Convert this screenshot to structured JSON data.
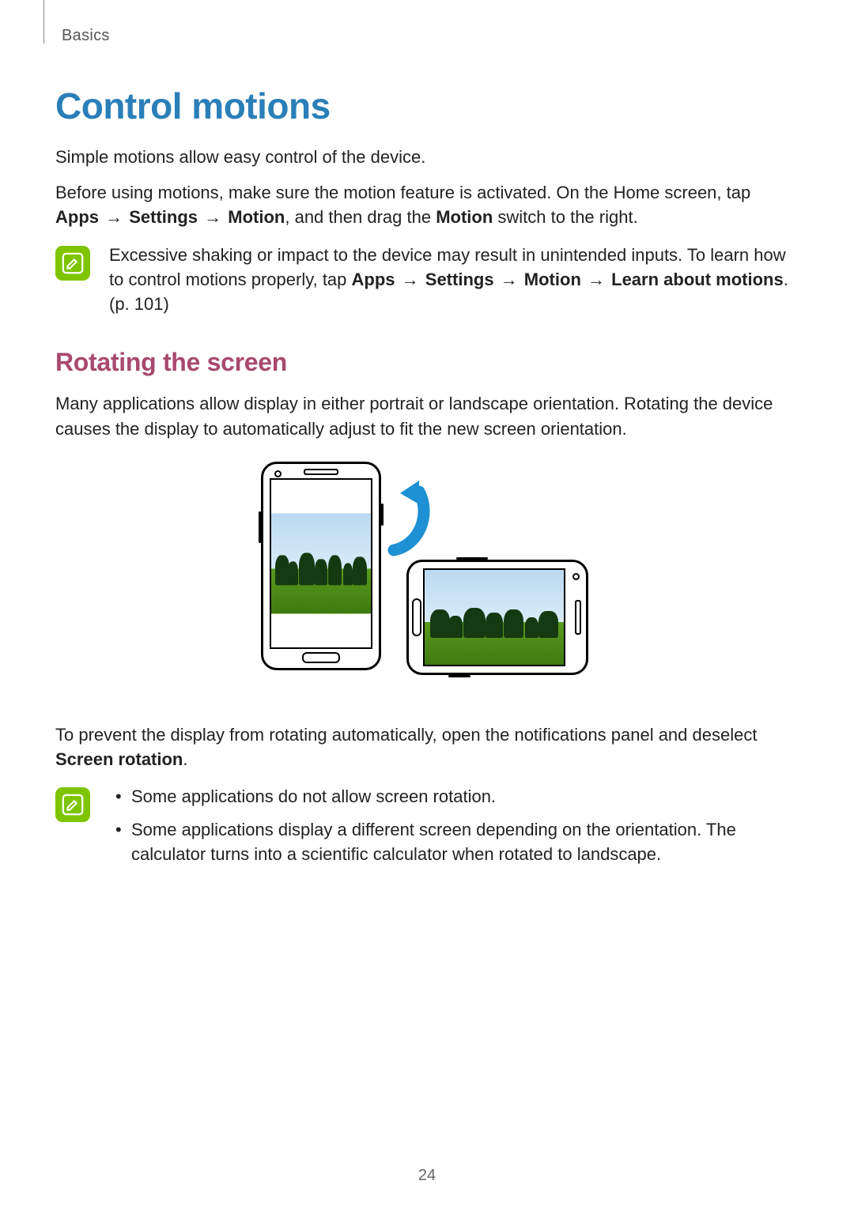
{
  "breadcrumb": "Basics",
  "title": "Control motions",
  "intro1": "Simple motions allow easy control of the device.",
  "intro2": {
    "pre": "Before using motions, make sure the motion feature is activated. On the Home screen, tap ",
    "seq1a": "Apps",
    "arr": " → ",
    "seq1b": "Settings",
    "seq1c": "Motion",
    "mid": ", and then drag the ",
    "seq1d": "Motion",
    "post": " switch to the right."
  },
  "note1": {
    "pre": "Excessive shaking or impact to the device may result in unintended inputs. To learn how to control motions properly, tap ",
    "seqA": "Apps",
    "arr": " → ",
    "seqB": "Settings",
    "seqC": "Motion",
    "seqD": "Learn about motions",
    "post": ". (p. 101)"
  },
  "subhead": "Rotating the screen",
  "rot_p1": "Many applications allow display in either portrait or landscape orientation. Rotating the device causes the display to automatically adjust to fit the new screen orientation.",
  "rot_p2": {
    "pre": "To prevent the display from rotating automatically, open the notifications panel and deselect ",
    "bold": "Screen rotation",
    "post": "."
  },
  "note2": {
    "li1": "Some applications do not allow screen rotation.",
    "li2": "Some applications display a different screen depending on the orientation. The calculator turns into a scientific calculator when rotated to landscape."
  },
  "page_number": "24"
}
